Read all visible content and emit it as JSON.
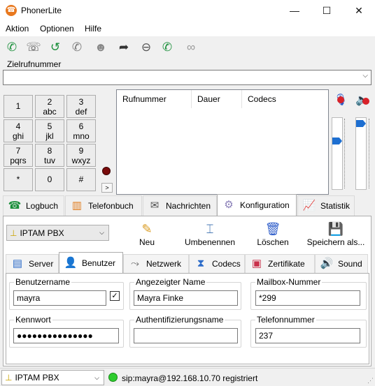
{
  "window": {
    "title": "PhonerLite"
  },
  "menu": [
    "Aktion",
    "Optionen",
    "Hilfe"
  ],
  "toolbar_icons": [
    "call-icon",
    "hold-icon",
    "redial-icon",
    "mute-icon",
    "conference-icon",
    "forward-icon",
    "stop-icon",
    "callback-icon",
    "mask-icon"
  ],
  "destination": {
    "label": "Zielrufnummer",
    "value": ""
  },
  "keypad": [
    {
      "digit": "1",
      "letters": ""
    },
    {
      "digit": "2",
      "letters": "abc"
    },
    {
      "digit": "3",
      "letters": "def"
    },
    {
      "digit": "4",
      "letters": "ghi"
    },
    {
      "digit": "5",
      "letters": "jkl"
    },
    {
      "digit": "6",
      "letters": "mno"
    },
    {
      "digit": "7",
      "letters": "pqrs"
    },
    {
      "digit": "8",
      "letters": "tuv"
    },
    {
      "digit": "9",
      "letters": "wxyz"
    },
    {
      "digit": "*",
      "letters": ""
    },
    {
      "digit": "0",
      "letters": ""
    },
    {
      "digit": "#",
      "letters": ""
    }
  ],
  "expand_label": ">",
  "call_list": {
    "columns": [
      "Rufnummer",
      "Dauer",
      "Codecs"
    ]
  },
  "volume": {
    "mic_level": 0.7,
    "speaker_level": 0.97
  },
  "tabs": [
    {
      "label": "Logbuch",
      "icon": "logbook-icon"
    },
    {
      "label": "Telefonbuch",
      "icon": "phonebook-icon"
    },
    {
      "label": "Nachrichten",
      "icon": "messages-icon"
    },
    {
      "label": "Konfiguration",
      "icon": "gear-icon",
      "active": true
    },
    {
      "label": "Statistik",
      "icon": "chart-icon"
    }
  ],
  "config": {
    "profile": "IPTAM PBX",
    "actions": {
      "new": "Neu",
      "rename": "Umbenennen",
      "delete": "Löschen",
      "save_as": "Speichern als..."
    },
    "subtabs": [
      {
        "label": "Server",
        "icon": "server-icon"
      },
      {
        "label": "Benutzer",
        "icon": "user-icon",
        "active": true
      },
      {
        "label": "Netzwerk",
        "icon": "network-icon"
      },
      {
        "label": "Codecs",
        "icon": "codec-icon"
      },
      {
        "label": "Zertifikate",
        "icon": "certificate-icon"
      },
      {
        "label": "Sound",
        "icon": "speaker-icon"
      }
    ],
    "user": {
      "username_label": "Benutzername",
      "username": "mayra",
      "username_checked": true,
      "display_name_label": "Angezeigter Name",
      "display_name": "Mayra Finke",
      "mailbox_label": "Mailbox-Nummer",
      "mailbox": "*299",
      "password_label": "Kennwort",
      "password": "●●●●●●●●●●●●●●●",
      "auth_name_label": "Authentifizierungsname",
      "auth_name": "",
      "phone_label": "Telefonnummer",
      "phone": "237"
    }
  },
  "status": {
    "profile": "IPTAM PBX",
    "text": "sip:mayra@192.168.10.70 registriert",
    "led_color": "#2ecc2e"
  }
}
